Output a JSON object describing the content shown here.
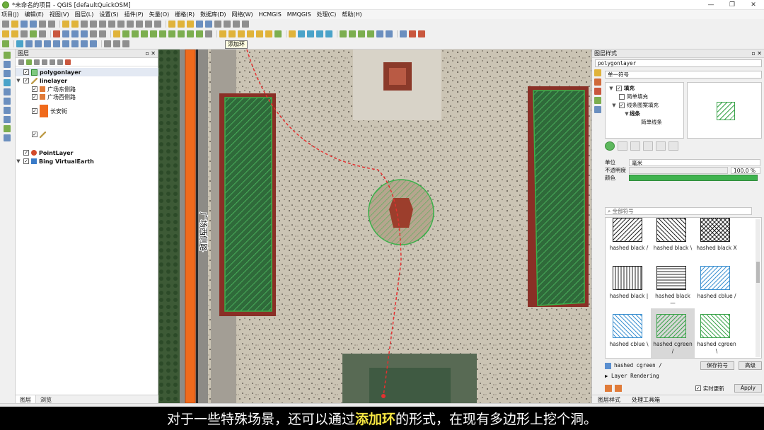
{
  "window": {
    "title": "*未命名的项目 - QGIS [defaultQuickOSM]",
    "controls": [
      "—",
      "❐",
      "✕"
    ]
  },
  "menu": [
    "项目(J)",
    "编辑(E)",
    "视图(V)",
    "图层(L)",
    "设置(S)",
    "插件(P)",
    "矢量(O)",
    "栅格(R)",
    "数据库(D)",
    "网络(W)",
    "HCMGIS",
    "MMQGIS",
    "处理(C)",
    "帮助(H)"
  ],
  "tooltip": "添加环",
  "layers_panel": {
    "title": "图层",
    "items": [
      {
        "name": "polygonlayer"
      },
      {
        "name": "linelayer"
      },
      {
        "name": "广场东侧路"
      },
      {
        "name": "广场西侧路"
      },
      {
        "name": "长安街"
      },
      {
        "name": "PointLayer"
      },
      {
        "name": "Bing VirtualEarth"
      }
    ],
    "tabs": [
      "图层",
      "浏览"
    ]
  },
  "map": {
    "road_label": "广场西侧路"
  },
  "style_panel": {
    "title": "图层样式",
    "layer": "polygonlayer",
    "symbol_type": "单一符号",
    "tree": {
      "fill": "填充",
      "simple_fill": "简单填充",
      "line_pattern_fill": "线条图案填充",
      "line": "线条",
      "simple_line": "简单线条"
    },
    "unit_label": "单位",
    "unit_value": "毫米",
    "opacity_label": "不透明度",
    "opacity_value": "100.0 %",
    "color_label": "颜色",
    "search_placeholder": "全部符号",
    "symbols": [
      {
        "label": "hashed black /",
        "color": "#222222"
      },
      {
        "label": "hashed black \\",
        "color": "#222222"
      },
      {
        "label": "hashed black X",
        "color": "#222222"
      },
      {
        "label": "hashed black |",
        "color": "#222222"
      },
      {
        "label": "hashed black\n—",
        "color": "#222222"
      },
      {
        "label": "hashed cblue /",
        "color": "#3a8fd0"
      },
      {
        "label": "hashed cblue \\",
        "color": "#3a8fd0"
      },
      {
        "label": "hashed cgreen\n/",
        "color": "#3aa34a"
      },
      {
        "label": "hashed cgreen\n\\",
        "color": "#3aa34a"
      }
    ],
    "selected_symbol": "hashed cgreen /",
    "save_symbol": "保存符号",
    "advanced": "高级",
    "layer_rendering": "Layer Rendering",
    "live_update": "实时更新",
    "apply": "Apply",
    "tabs": [
      "图层样式",
      "处理工具箱"
    ]
  },
  "subtitle": {
    "before": "对于一些特殊场景，还可以通过",
    "highlight": "添加环",
    "after": "的形式，在现有多边形上挖个洞。"
  },
  "colors": {
    "accent_green": "#3aa34a",
    "road_orange": "#f06a1c",
    "highlight_yellow": "#f5e542"
  }
}
